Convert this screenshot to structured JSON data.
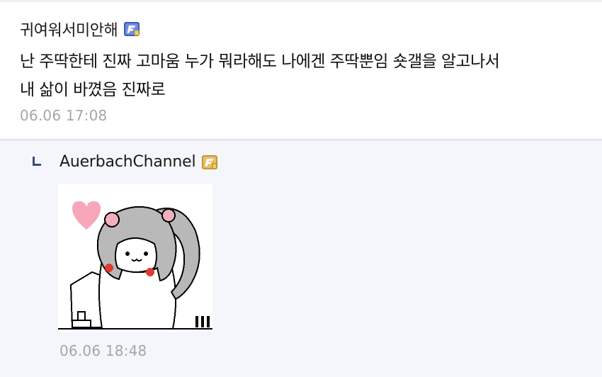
{
  "comment": {
    "author": "귀여워서미안해",
    "text_line1": "난 주딱한테 진짜 고마움 누가 뭐라해도 나에겐 주딱뿐임 숏갤을 알고나서",
    "text_line2": "내 삶이 바꼈음 진짜로",
    "timestamp": "06.06 17:08",
    "badge_icon": "fixed-nick-badge-icon"
  },
  "reply": {
    "author": "AuerbachChannel",
    "timestamp": "06.06 18:48",
    "marker_icon": "reply-arrow-icon",
    "badge_icon": "fixed-nick-badge-icon-gold",
    "sticker": "hamster-girl-sticker"
  },
  "colors": {
    "reply_bg": "#f4f6fb",
    "timestamp": "#a3a7ad",
    "badge_blue": "#3a5bbf",
    "badge_gold": "#c9973a",
    "reply_marker": "#3d4a7a"
  }
}
